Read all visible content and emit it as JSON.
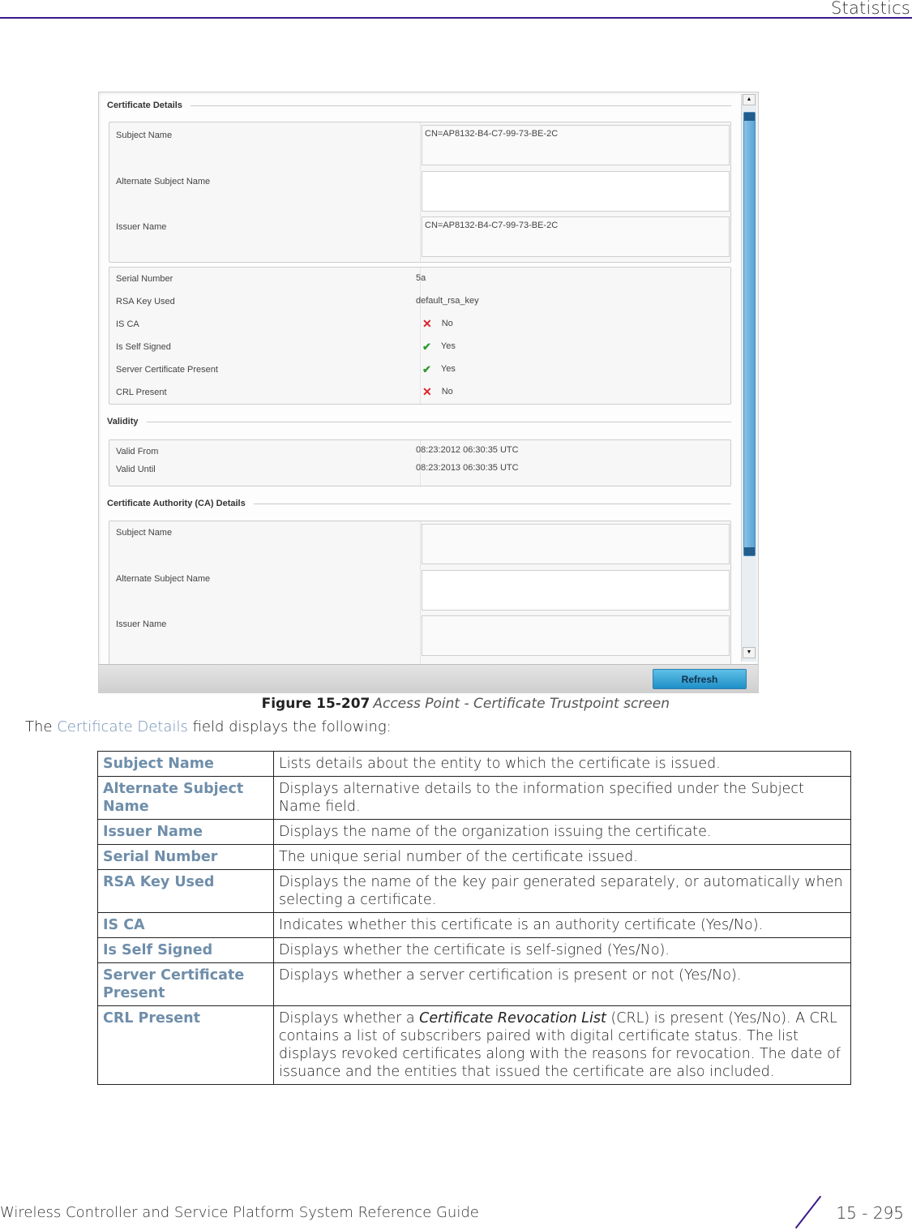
{
  "header": {
    "title": "Statistics"
  },
  "screen": {
    "sections": {
      "certificate_details": "Certificate Details",
      "validity": "Validity",
      "ca_details": "Certificate Authority (CA) Details"
    },
    "certificate_details": {
      "subject_name": {
        "label": "Subject Name",
        "value": "CN=AP8132-B4-C7-99-73-BE-2C"
      },
      "alternate_subject_name": {
        "label": "Alternate Subject Name",
        "value": ""
      },
      "issuer_name": {
        "label": "Issuer Name",
        "value": "CN=AP8132-B4-C7-99-73-BE-2C"
      }
    },
    "properties": [
      {
        "label": "Serial Number",
        "value": "5a",
        "icon": ""
      },
      {
        "label": "RSA Key Used",
        "value": "default_rsa_key",
        "icon": ""
      },
      {
        "label": "IS CA",
        "value": "No",
        "icon": "x-icon"
      },
      {
        "label": "Is Self Signed",
        "value": "Yes",
        "icon": "check-icon"
      },
      {
        "label": "Server Certificate Present",
        "value": "Yes",
        "icon": "check-icon"
      },
      {
        "label": "CRL Present",
        "value": "No",
        "icon": "x-icon"
      }
    ],
    "validity": {
      "valid_from": {
        "label": "Valid From",
        "value": "08:23:2012 06:30:35 UTC"
      },
      "valid_until": {
        "label": "Valid Until",
        "value": "08:23:2013 06:30:35 UTC"
      }
    },
    "ca_details": {
      "subject_name": {
        "label": "Subject Name",
        "value": ""
      },
      "alternate_subject_name": {
        "label": "Alternate Subject Name",
        "value": ""
      },
      "issuer_name": {
        "label": "Issuer Name",
        "value": ""
      }
    },
    "refresh_label": "Refresh"
  },
  "caption": {
    "figure": "Figure 15-207",
    "description": "Access Point - Certificate Trustpoint screen"
  },
  "intro": {
    "prefix": "The ",
    "link": "Certificate Details",
    "suffix": " field displays the following:"
  },
  "table": [
    {
      "term": "Subject Name",
      "definition": "Lists details about the entity to which the certificate is issued."
    },
    {
      "term": "Alternate Subject Name",
      "definition": "Displays alternative details to the information specified under the Subject Name field."
    },
    {
      "term": "Issuer Name",
      "definition": "Displays the name of the organization issuing the certificate."
    },
    {
      "term": "Serial Number",
      "definition": "The unique serial number of the certificate issued."
    },
    {
      "term": "RSA Key Used",
      "definition": "Displays the name of the key pair generated separately, or automatically when selecting a certificate."
    },
    {
      "term": "IS CA",
      "definition": "Indicates whether this certificate is an authority certificate (Yes/No)."
    },
    {
      "term": "Is Self Signed",
      "definition": "Displays whether the certificate is self-signed (Yes/No)."
    },
    {
      "term": "Server Certificate Present",
      "definition": "Displays whether a server certification is present or not (Yes/No)."
    },
    {
      "term": "CRL Present",
      "definition_pre": "Displays whether a ",
      "definition_em": "Certificate Revocation List",
      "definition_post": " (CRL) is present (Yes/No). A CRL contains a list of subscribers paired with digital certificate status. The list displays revoked certificates along with the reasons for revocation. The date of issuance and the entities that issued the certificate are also included."
    }
  ],
  "footer": {
    "guide_title": "Wireless Controller and Service Platform System Reference Guide",
    "page": "15 - 295"
  }
}
